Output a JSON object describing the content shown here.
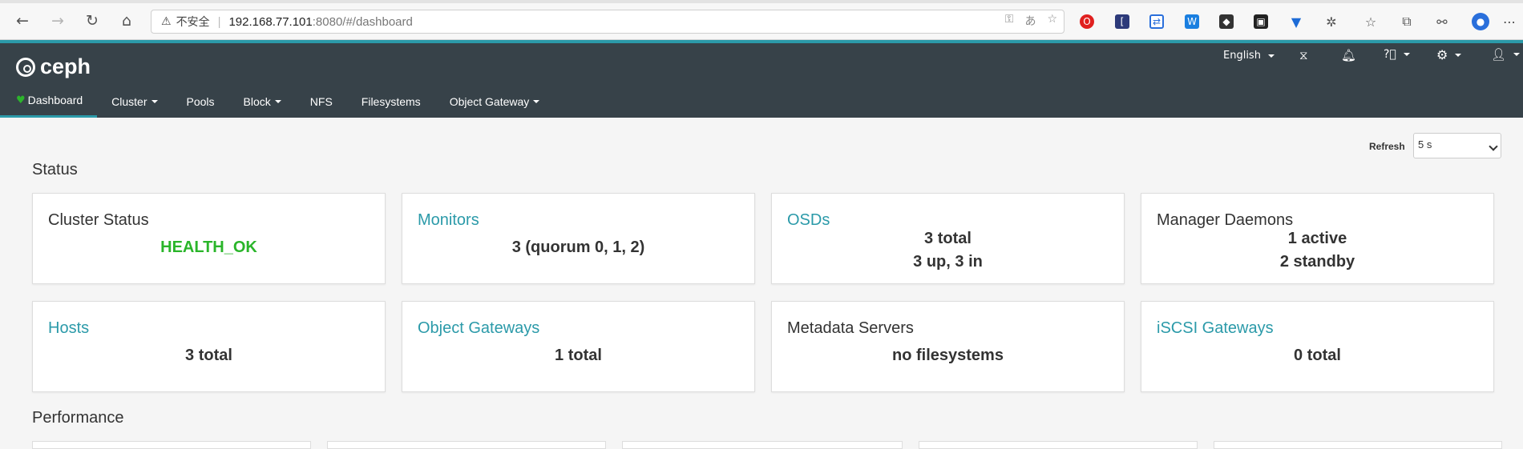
{
  "browser": {
    "security_warning": "不安全",
    "url_host": "192.168.77.101",
    "url_rest": ":8080/#/dashboard"
  },
  "navbar": {
    "brand": "ceph",
    "language": "English",
    "items": [
      {
        "label": "Dashboard"
      },
      {
        "label": "Cluster"
      },
      {
        "label": "Pools"
      },
      {
        "label": "Block"
      },
      {
        "label": "NFS"
      },
      {
        "label": "Filesystems"
      },
      {
        "label": "Object Gateway"
      }
    ]
  },
  "refresh": {
    "label": "Refresh",
    "value": "5 s"
  },
  "sections": {
    "status": "Status",
    "performance": "Performance"
  },
  "cards": [
    {
      "title": "Cluster Status",
      "lines": [
        "HEALTH_OK"
      ]
    },
    {
      "title": "Monitors",
      "lines": [
        "3 (quorum 0, 1, 2)"
      ]
    },
    {
      "title": "OSDs",
      "lines": [
        "3 total",
        "3 up, 3 in"
      ]
    },
    {
      "title": "Manager Daemons",
      "lines": [
        "1 active",
        "2 standby"
      ]
    },
    {
      "title": "Hosts",
      "lines": [
        "3 total"
      ]
    },
    {
      "title": "Object Gateways",
      "lines": [
        "1 total"
      ]
    },
    {
      "title": "Metadata Servers",
      "lines": [
        "no filesystems"
      ]
    },
    {
      "title": "iSCSI Gateways",
      "lines": [
        "0 total"
      ]
    }
  ],
  "colors": {
    "accent": "#2b9aa9",
    "navbar": "#374249",
    "health_ok": "#2ab52a"
  }
}
